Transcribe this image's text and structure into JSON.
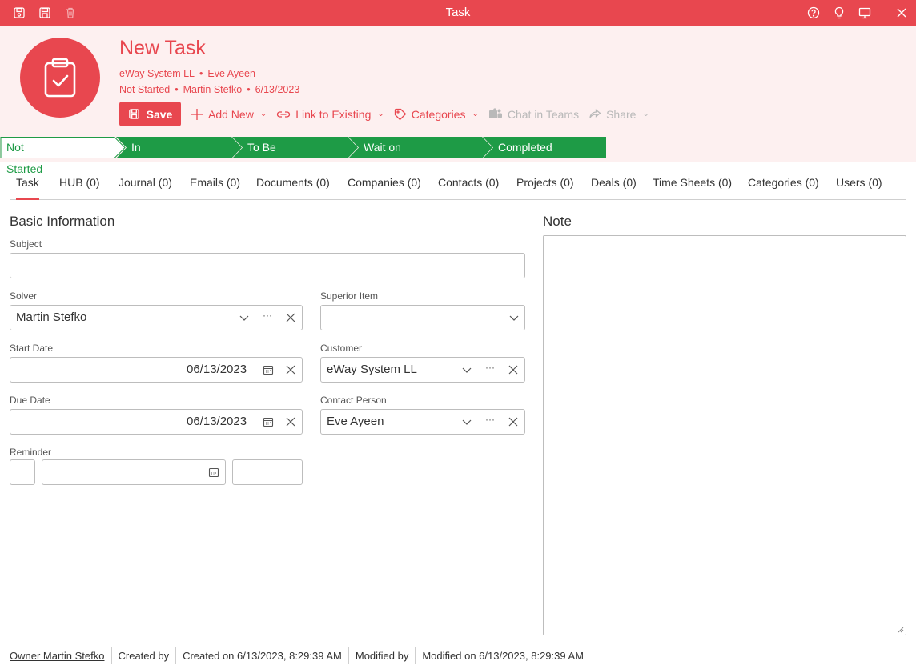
{
  "window": {
    "title": "Task",
    "left_icons": [
      "save-icon",
      "save-close-icon",
      "delete-icon"
    ],
    "right_icons": [
      "help-icon",
      "lightbulb-icon",
      "monitor-icon",
      "close-icon"
    ]
  },
  "header": {
    "title": "New Task",
    "customer": "eWay System LL",
    "contact": "Eve Ayeen",
    "state": "Not Started",
    "solver": "Martin Stefko",
    "date": "6/13/2023",
    "separator": "•"
  },
  "toolbar": {
    "save": "Save",
    "add_new": "Add New",
    "link_existing": "Link to Existing",
    "categories": "Categories",
    "chat_teams": "Chat in Teams",
    "share": "Share"
  },
  "stages": [
    "Not Started",
    "In Progress",
    "To Be Reviewed",
    "Wait on Someone Else",
    "Completed"
  ],
  "stage_colors": {
    "active_fill": "#ffffff",
    "done_fill": "#1e9b46",
    "border": "#1e9b46",
    "active_text": "#1e9b46"
  },
  "tabs": [
    "Task",
    "HUB (0)",
    "Journal (0)",
    "Emails (0)",
    "Documents (0)",
    "Companies (0)",
    "Contacts (0)",
    "Projects (0)",
    "Deals (0)",
    "Time Sheets (0)",
    "Categories (0)",
    "Users (0)"
  ],
  "form": {
    "section_basic": "Basic Information",
    "section_note": "Note",
    "subject_label": "Subject",
    "subject_value": "",
    "solver_label": "Solver",
    "solver_value": "Martin Stefko",
    "superior_label": "Superior Item",
    "superior_value": "",
    "start_label": "Start Date",
    "start_value": "06/13/2023",
    "customer_label": "Customer",
    "customer_value": "eWay System LL",
    "due_label": "Due Date",
    "due_value": "06/13/2023",
    "contact_label": "Contact Person",
    "contact_value": "Eve Ayeen",
    "reminder_label": "Reminder",
    "more_glyph": "···"
  },
  "footer": {
    "owner": "Owner Martin Stefko",
    "created_by": "Created by",
    "created_on": "Created on 6/13/2023, 8:29:39 AM",
    "modified_by": "Modified by",
    "modified_on": "Modified on 6/13/2023, 8:29:39 AM"
  },
  "colors": {
    "accent": "#e8474f",
    "header_bg": "#fdf0f0",
    "stage_green": "#1e9b46",
    "disabled": "#b9b9b9"
  }
}
